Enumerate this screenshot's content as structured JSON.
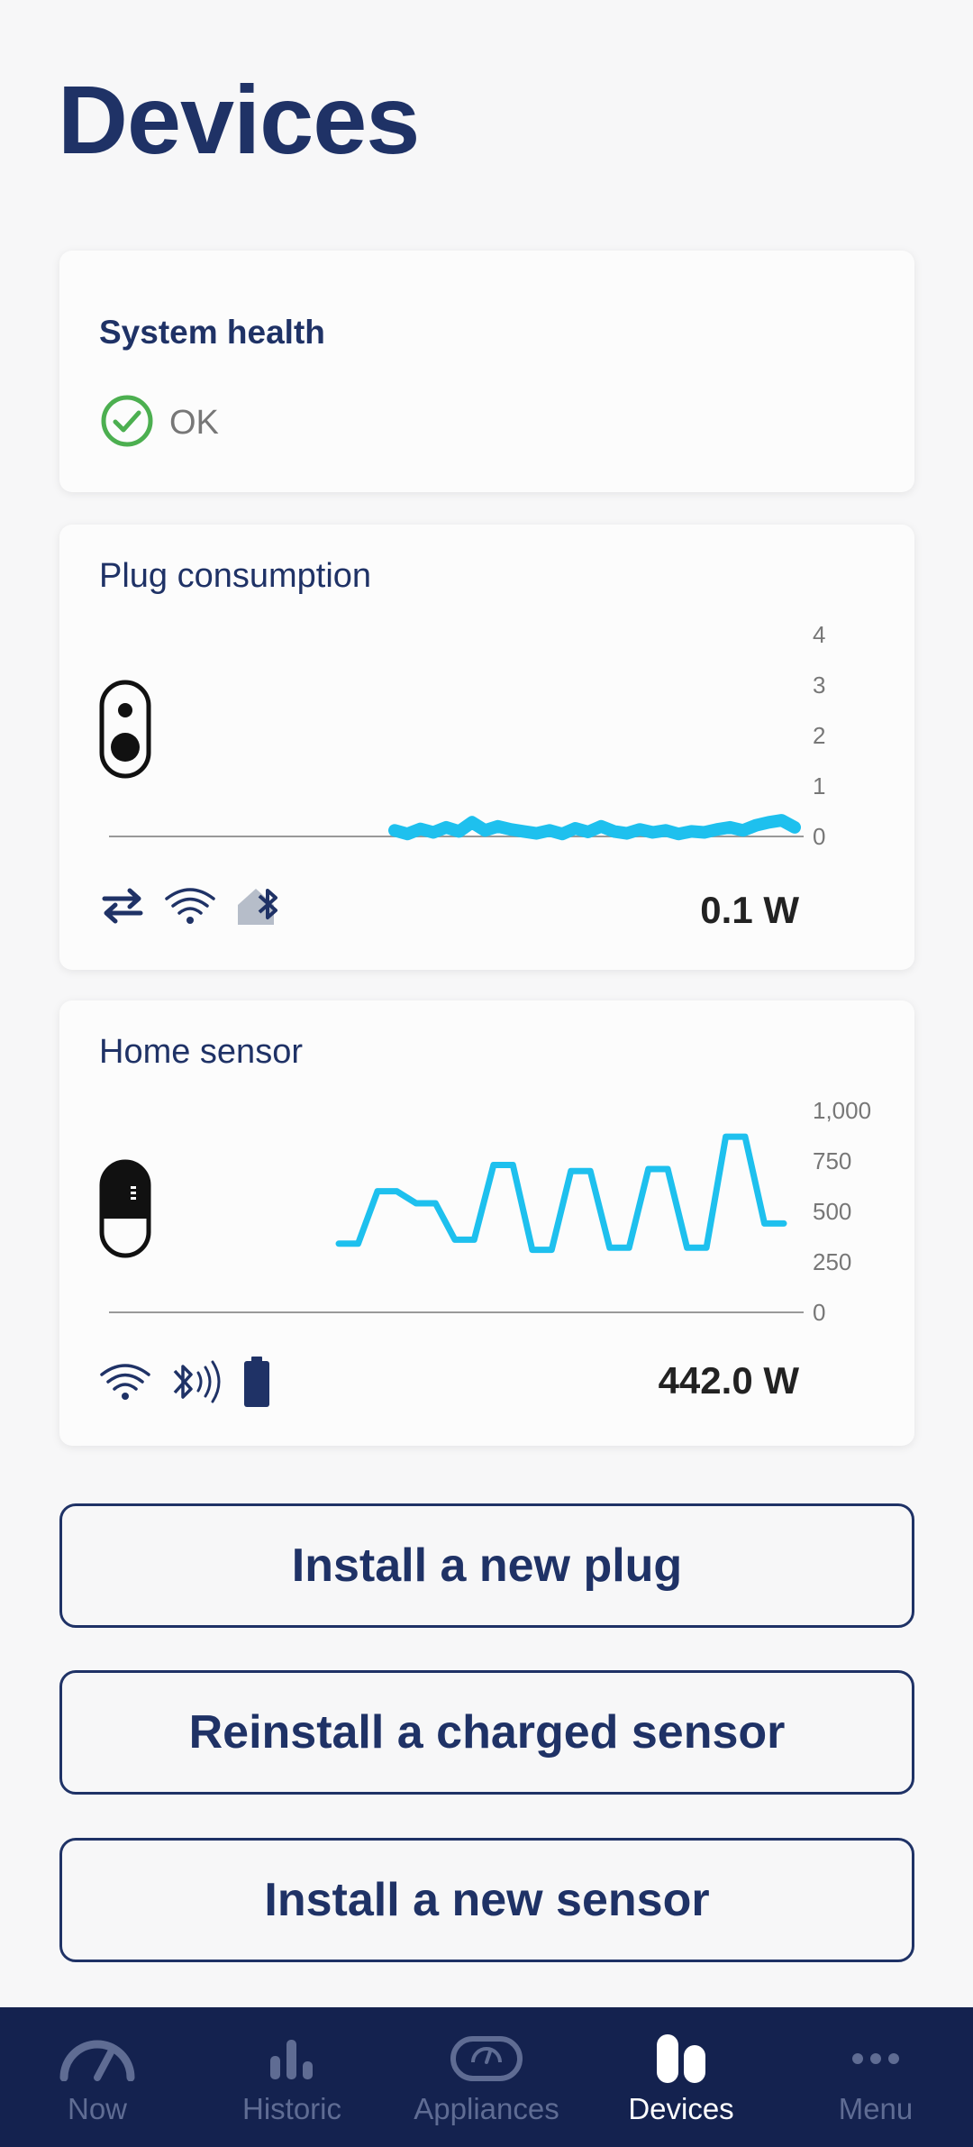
{
  "page": {
    "title": "Devices"
  },
  "health": {
    "title": "System health",
    "status": "OK",
    "status_color": "#4caf50"
  },
  "plug": {
    "title": "Plug consumption",
    "power": "0.1 W",
    "icons": [
      "swap-arrows-icon",
      "wifi-icon",
      "home-bluetooth-icon"
    ],
    "chart_data": {
      "type": "line",
      "y_ticks": [
        "4",
        "3",
        "2",
        "1",
        "0"
      ],
      "ylim": [
        0,
        4
      ],
      "values": [
        0.12,
        0.05,
        0.15,
        0.08,
        0.18,
        0.1,
        0.28,
        0.12,
        0.2,
        0.14,
        0.1,
        0.06,
        0.12,
        0.05,
        0.16,
        0.09,
        0.2,
        0.1,
        0.06,
        0.14,
        0.08,
        0.12,
        0.05,
        0.1,
        0.08,
        0.14,
        0.18,
        0.12,
        0.22,
        0.28,
        0.32,
        0.18
      ],
      "color": "#1ec0ee"
    }
  },
  "sensor": {
    "title": "Home sensor",
    "power": "442.0 W",
    "icons": [
      "wifi-icon",
      "bluetooth-signal-icon",
      "battery-icon"
    ],
    "chart_data": {
      "type": "line",
      "y_ticks": [
        "1,000",
        "750",
        "500",
        "250",
        "0"
      ],
      "ylim": [
        0,
        1000
      ],
      "values": [
        340,
        340,
        600,
        600,
        540,
        540,
        360,
        360,
        730,
        730,
        310,
        310,
        700,
        700,
        320,
        320,
        710,
        710,
        320,
        320,
        870,
        870,
        440,
        440
      ],
      "color": "#1ec0ee"
    }
  },
  "buttons": {
    "install_plug": "Install a new plug",
    "reinstall_sensor": "Reinstall a charged sensor",
    "install_sensor": "Install a new sensor"
  },
  "nav": {
    "items": [
      {
        "label": "Now",
        "icon": "gauge-icon"
      },
      {
        "label": "Historic",
        "icon": "bar-chart-icon"
      },
      {
        "label": "Appliances",
        "icon": "appliance-icon"
      },
      {
        "label": "Devices",
        "icon": "devices-icon",
        "active": true
      },
      {
        "label": "Menu",
        "icon": "more-dots-icon"
      }
    ]
  }
}
